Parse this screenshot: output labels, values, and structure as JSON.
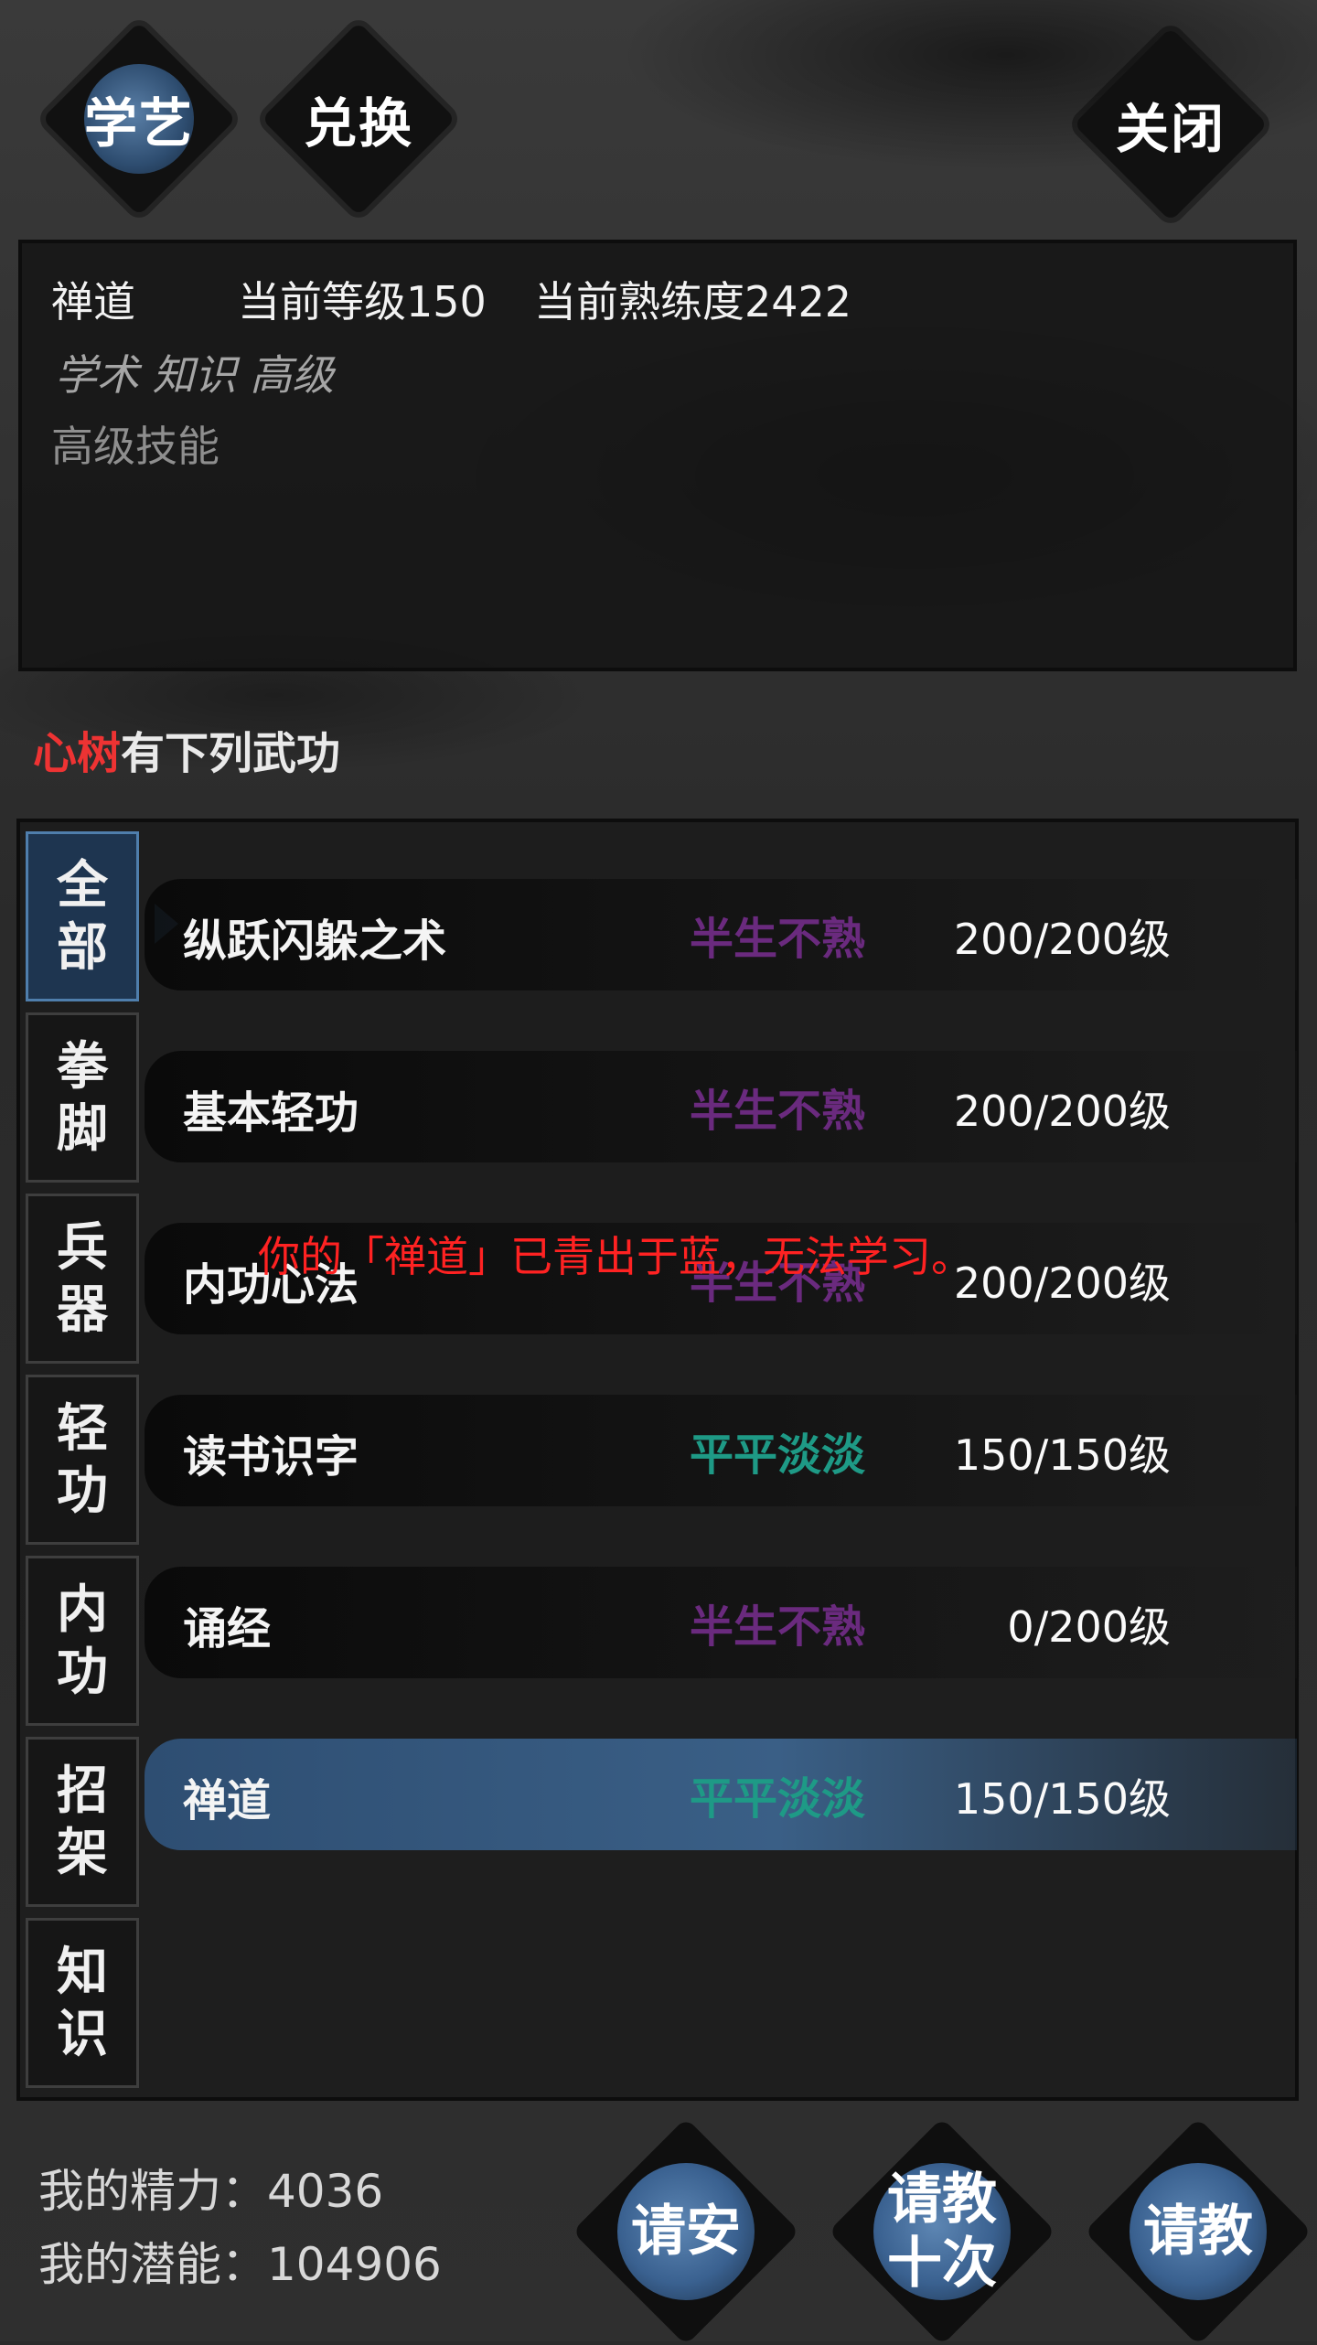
{
  "tabs": {
    "learn": "学艺",
    "exchange": "兑换",
    "close": "关闭"
  },
  "info": {
    "name": "禅道",
    "level": "当前等级150",
    "proficiency": "当前熟练度2422",
    "categories": "学术 知识 高级",
    "description": "高级技能"
  },
  "section": {
    "master": "心树",
    "text": "有下列武功"
  },
  "categories": [
    {
      "c1": "全",
      "c2": "部"
    },
    {
      "c1": "拳",
      "c2": "脚"
    },
    {
      "c1": "兵",
      "c2": "器"
    },
    {
      "c1": "轻",
      "c2": "功"
    },
    {
      "c1": "内",
      "c2": "功"
    },
    {
      "c1": "招",
      "c2": "架"
    },
    {
      "c1": "知",
      "c2": "识"
    }
  ],
  "skills": [
    {
      "name": "纵跃闪躲之术",
      "grade": "半生不熟",
      "level": "200/200级"
    },
    {
      "name": "基本轻功",
      "grade": "半生不熟",
      "level": "200/200级"
    },
    {
      "name": "内功心法",
      "grade": "半生不熟",
      "level": "200/200级"
    },
    {
      "name": "读书识字",
      "grade": "平平淡淡",
      "level": "150/150级"
    },
    {
      "name": "诵经",
      "grade": "半生不熟",
      "level": "0/200级"
    },
    {
      "name": "禅道",
      "grade": "平平淡淡",
      "level": "150/150级"
    }
  ],
  "grade_colors": {
    "半生不熟": "#6a2a7e",
    "平平淡淡": "#1e9a86"
  },
  "message": "你的「禅道」已青出于蓝，无法学习。",
  "stats": {
    "energy": "我的精力：4036",
    "potential": "我的潜能：104906"
  },
  "buttons": {
    "greet": "请安",
    "ask_ten_1": "请教",
    "ask_ten_2": "十次",
    "ask": "请教"
  }
}
